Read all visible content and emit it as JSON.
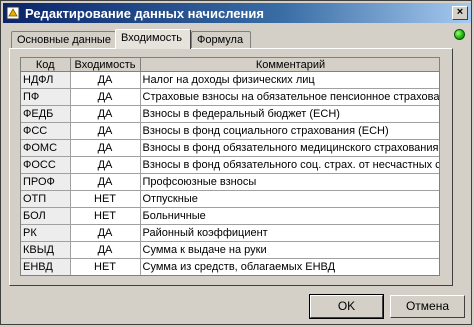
{
  "window": {
    "title": "Редактирование данных начисления",
    "close_label": "×"
  },
  "tabs": [
    {
      "label": "Основные данные",
      "active": false
    },
    {
      "label": "Входимость",
      "active": true
    },
    {
      "label": "Формула",
      "active": false
    }
  ],
  "status_color": "#22b60e",
  "table": {
    "columns": [
      "Код",
      "Входимость",
      "Комментарий"
    ],
    "rows": [
      {
        "code": "НДФЛ",
        "incl": "ДА",
        "comment": "Налог на доходы физических лиц"
      },
      {
        "code": "ПФ",
        "incl": "ДА",
        "comment": "Страховые взносы на обязательное пенсионное страхование"
      },
      {
        "code": "ФЕДБ",
        "incl": "ДА",
        "comment": "Взносы в федеральный бюджет (ЕСН)"
      },
      {
        "code": "ФСС",
        "incl": "ДА",
        "comment": "Взносы в фонд социального страхования (ЕСН)"
      },
      {
        "code": "ФОМС",
        "incl": "ДА",
        "comment": "Взносы в фонд обязательного медицинского страхования"
      },
      {
        "code": "ФОСС",
        "incl": "ДА",
        "comment": "Взносы в фонд обязательного соц. страх. от несчастных случаев"
      },
      {
        "code": "ПРОФ",
        "incl": "ДА",
        "comment": "Профсоюзные взносы"
      },
      {
        "code": "ОТП",
        "incl": "НЕТ",
        "comment": "Отпускные"
      },
      {
        "code": "БОЛ",
        "incl": "НЕТ",
        "comment": "Больничные"
      },
      {
        "code": "РК",
        "incl": "ДА",
        "comment": "Районный коэффициент"
      },
      {
        "code": "КВЫД",
        "incl": "ДА",
        "comment": "Сумма к выдаче на руки"
      },
      {
        "code": "ЕНВД",
        "incl": "НЕТ",
        "comment": "Сумма из средств, облагаемых ЕНВД"
      }
    ]
  },
  "buttons": {
    "ok": "OK",
    "cancel": "Отмена"
  }
}
